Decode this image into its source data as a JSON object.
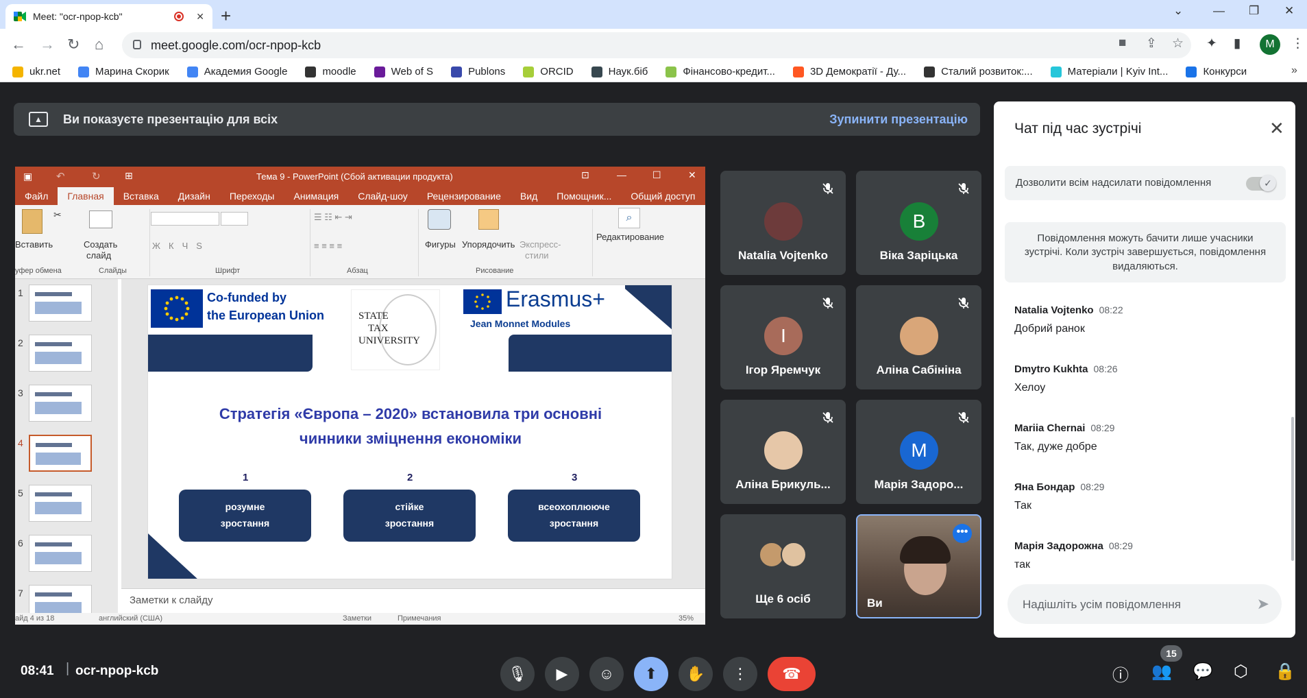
{
  "browser": {
    "tab_title": "Meet: \"ocr-npop-kcb\"",
    "url": "meet.google.com/ocr-npop-kcb",
    "avatar_letter": "M",
    "bookmarks": [
      {
        "label": "ukr.net",
        "color": "#f4b400"
      },
      {
        "label": "Марина Скорик",
        "color": "#4285f4"
      },
      {
        "label": "Академия Google",
        "color": "#4285f4"
      },
      {
        "label": "moodle",
        "color": "#333333"
      },
      {
        "label": "Web of S",
        "color": "#6a1b9a"
      },
      {
        "label": "Publons",
        "color": "#3949ab"
      },
      {
        "label": "ORCID",
        "color": "#a6ce39"
      },
      {
        "label": "Наук.біб",
        "color": "#37474f"
      },
      {
        "label": "Фінансово-кредит...",
        "color": "#8bc34a"
      },
      {
        "label": "3D Демократії - Ду...",
        "color": "#ff5722"
      },
      {
        "label": "Сталий розвиток:...",
        "color": "#333333"
      },
      {
        "label": "Матеріали | Kyiv Int...",
        "color": "#26c6da"
      },
      {
        "label": "Конкурси",
        "color": "#1a73e8"
      }
    ]
  },
  "banner": {
    "text": "Ви показуєте презентацію для всіх",
    "stop_label": "Зупинити презентацію"
  },
  "ppt": {
    "title": "Тема 9 - PowerPoint (Сбой активации продукта)",
    "tabs": [
      "Файл",
      "Главная",
      "Вставка",
      "Дизайн",
      "Переходы",
      "Анимация",
      "Слайд-шоу",
      "Рецензирование",
      "Вид",
      "Помощник...",
      "Общий доступ"
    ],
    "ribbon": {
      "paste": "Вставить",
      "create_slide_1": "Создать",
      "create_slide_2": "слайд",
      "shapes": "Фигуры",
      "arrange": "Упорядочить",
      "express_1": "Экспресс-",
      "express_2": "стили",
      "editing": "Редактирование",
      "groups": [
        "уфер обмена",
        "Слайды",
        "Шрифт",
        "Абзац",
        "Рисование"
      ]
    },
    "thumb_numbers": [
      "1",
      "2",
      "3",
      "4",
      "5",
      "6",
      "7"
    ],
    "slide": {
      "eu_line1": "Co-funded by",
      "eu_line2": "the European Union",
      "stu_1": "STATE",
      "stu_2": "TAX",
      "stu_3": "UNIVERSITY",
      "erasmus": "Erasmus+",
      "jean": "Jean Monnet Modules",
      "heading_1": "Стратегія «Європа – 2020» встановила три основні",
      "heading_2": "чинники зміцнення економіки",
      "items": [
        {
          "num": "1",
          "line1": "розумне",
          "line2": "зростання"
        },
        {
          "num": "2",
          "line1": "стійке",
          "line2": "зростання"
        },
        {
          "num": "3",
          "line1": "всеохоплююче",
          "line2": "зростання"
        }
      ]
    },
    "notes_placeholder": "Заметки к слайду",
    "status": {
      "slide_info": "айд 4 из 18",
      "language": "английский (США)",
      "notes": "Заметки",
      "comments": "Примечания",
      "zoom": "35%"
    }
  },
  "participants": [
    {
      "name": "Natalia Vojtenko",
      "initial": "",
      "color": "#6d3b3b"
    },
    {
      "name": "Віка Заріцька",
      "initial": "B",
      "color": "#188038"
    },
    {
      "name": "Ігор Яремчук",
      "initial": "I",
      "color": "#a86b5a"
    },
    {
      "name": "Аліна Сабініна",
      "initial": "",
      "color": "#d9a679"
    },
    {
      "name": "Аліна Брикуль...",
      "initial": "",
      "color": "#e6c7a8"
    },
    {
      "name": "Марія Задоро...",
      "initial": "M",
      "color": "#1967d2"
    },
    {
      "name": "Ще 6 осіб",
      "initial": "",
      "color": "#8d6e63"
    },
    {
      "name": "Ви",
      "initial": "",
      "color": "#6b5a4f"
    }
  ],
  "chat": {
    "title": "Чат під час зустрічі",
    "allow_label": "Дозволити всім надсилати повідомлення",
    "notice": "Повідомлення можуть бачити лише учасники зустрічі. Коли зустріч завершується, повідомлення видаляються.",
    "messages": [
      {
        "sender": "Natalia Vojtenko",
        "time": "08:22",
        "text": "Добрий ранок"
      },
      {
        "sender": "Dmytro Kukhta",
        "time": "08:26",
        "text": "Хелоу"
      },
      {
        "sender": "Mariia Chernai",
        "time": "08:29",
        "text": "Так, дуже добре"
      },
      {
        "sender": "Яна Бондар",
        "time": "08:29",
        "text": "Так"
      },
      {
        "sender": "Марія Задорожна",
        "time": "08:29",
        "text": "так"
      }
    ],
    "input_placeholder": "Надішліть усім повідомлення"
  },
  "bottom": {
    "time": "08:41",
    "meeting_code": "ocr-npop-kcb",
    "participant_count": "15"
  }
}
